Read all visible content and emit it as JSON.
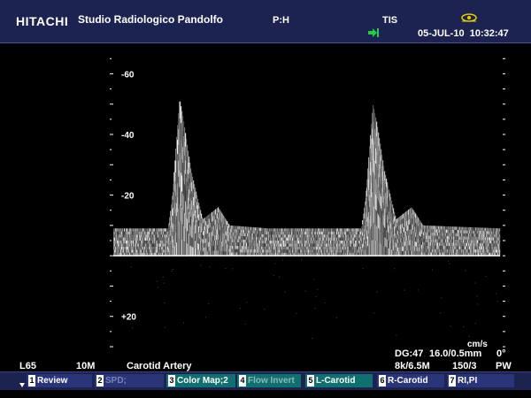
{
  "header": {
    "brand": "HITACHI",
    "clinic": "Studio Radiologico Pandolfo",
    "ph": "P:H",
    "tis": "TIS",
    "date": "05-JUL-10",
    "time": "10:32:47"
  },
  "chart_data": {
    "type": "area",
    "title": "",
    "ylabel": "cm/s",
    "y_ticks": [
      {
        "label": "-60",
        "value": -60
      },
      {
        "label": "-40",
        "value": -40
      },
      {
        "label": "-20",
        "value": -20
      },
      {
        "label": "+20",
        "value": 20
      }
    ],
    "ylim": [
      -68,
      30
    ],
    "baseline": 0,
    "series": [
      {
        "values": [
          {
            "t": 0.0,
            "v": -9
          },
          {
            "t": 0.14,
            "v": -9
          },
          {
            "t": 0.15,
            "v": -18
          },
          {
            "t": 0.17,
            "v": -52
          },
          {
            "t": 0.18,
            "v": -45
          },
          {
            "t": 0.2,
            "v": -28
          },
          {
            "t": 0.23,
            "v": -12
          },
          {
            "t": 0.27,
            "v": -16
          },
          {
            "t": 0.3,
            "v": -10
          },
          {
            "t": 0.4,
            "v": -9
          },
          {
            "t": 0.64,
            "v": -9
          },
          {
            "t": 0.65,
            "v": -18
          },
          {
            "t": 0.67,
            "v": -50
          },
          {
            "t": 0.68,
            "v": -44
          },
          {
            "t": 0.7,
            "v": -28
          },
          {
            "t": 0.73,
            "v": -12
          },
          {
            "t": 0.77,
            "v": -16
          },
          {
            "t": 0.8,
            "v": -10
          },
          {
            "t": 1.0,
            "v": -9
          }
        ]
      }
    ]
  },
  "info": {
    "line1": {
      "dg": "DG:47",
      "depth": "16.0/0.5mm",
      "angle": "0°"
    },
    "line2": {
      "probe": "L65",
      "freq": "10M",
      "region": "Carotid Artery",
      "sample": "8k/6.5M",
      "ratio": "150/3",
      "mode": "PW"
    }
  },
  "menu": [
    {
      "num": "1",
      "label": "Review"
    },
    {
      "num": "2",
      "label": "SPD;"
    },
    {
      "num": "3",
      "label": "Color Map;2"
    },
    {
      "num": "4",
      "label": "Flow Invert"
    },
    {
      "num": "5",
      "label": "L-Carotid"
    },
    {
      "num": "6",
      "label": "R-Carotid"
    },
    {
      "num": "7",
      "label": "RI,PI"
    }
  ]
}
